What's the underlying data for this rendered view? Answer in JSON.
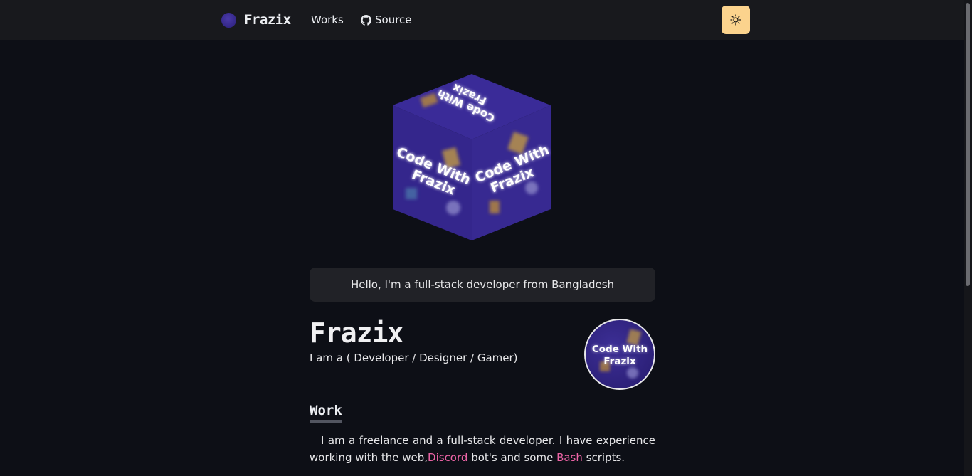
{
  "brand": {
    "name": "Frazix",
    "logo_text": "Code With Frazix"
  },
  "nav": {
    "works": "Works",
    "source": "Source"
  },
  "cube": {
    "face_label_line1": "Code With",
    "face_label_line2": "Frazix",
    "color": "#3b2a9a"
  },
  "hello": "Hello, I'm a full-stack developer from Bangladesh",
  "profile": {
    "name": "Frazix",
    "tagline": "I am a ( Developer / Designer / Gamer)",
    "avatar_line1": "Code With",
    "avatar_line2": "Frazix"
  },
  "work": {
    "heading": "Work",
    "text_1": "I am a freelance and a full-stack developer. I have experience working with the web,",
    "link_discord": "Discord",
    "text_2": " bot's and some ",
    "link_bash": "Bash",
    "text_3": " scripts."
  },
  "colors": {
    "accent_link": "#ed64a6",
    "toggle_bg": "#fbd38d",
    "background": "#0d0f16"
  },
  "icons": {
    "theme_toggle": "sun-icon",
    "source": "github-icon"
  }
}
